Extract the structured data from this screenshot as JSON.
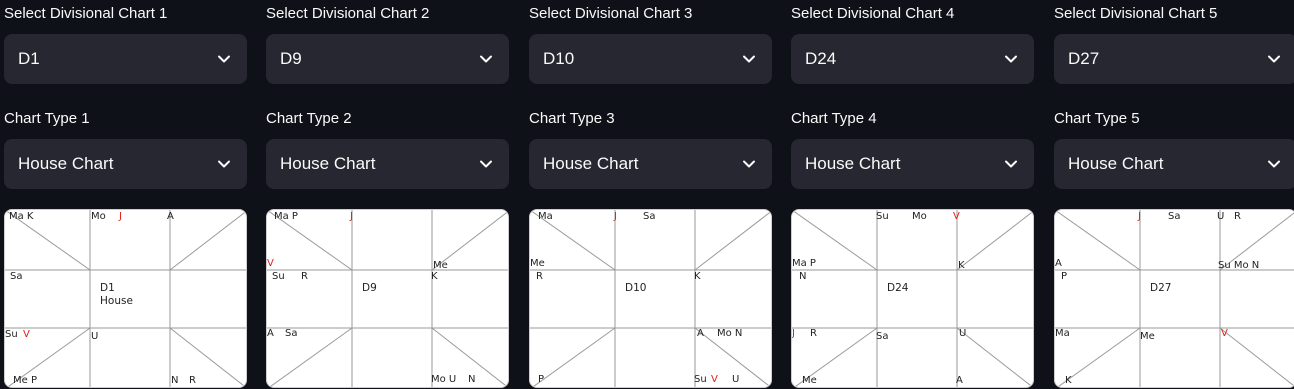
{
  "divisional_labels": [
    "Select Divisional Chart 1",
    "Select Divisional Chart 2",
    "Select Divisional Chart 3",
    "Select Divisional Chart 4",
    "Select Divisional Chart 5"
  ],
  "divisional_values": [
    "D1",
    "D9",
    "D10",
    "D24",
    "D27"
  ],
  "type_labels": [
    "Chart Type 1",
    "Chart Type 2",
    "Chart Type 3",
    "Chart Type 4",
    "Chart Type 5"
  ],
  "type_values": [
    "House Chart",
    "House Chart",
    "House Chart",
    "House Chart",
    "House Chart"
  ],
  "icons": {
    "dropdown": "chevron-down-icon"
  },
  "colors": {
    "background": "#0e1117",
    "select_bg": "#262730",
    "chart_bg": "#ffffff",
    "planet_red": "#e0201a"
  },
  "charts": [
    {
      "title": "D1",
      "subtitle": "House",
      "planets": [
        {
          "text": "Ma K",
          "red": false
        },
        {
          "text": "Mo",
          "red": false
        },
        {
          "text": "J",
          "red": true
        },
        {
          "text": "A",
          "red": false
        },
        {
          "text": "Sa",
          "red": false
        },
        {
          "text": "Su",
          "red": false
        },
        {
          "text": "V",
          "red": true
        },
        {
          "text": "U",
          "red": false
        },
        {
          "text": "Me P",
          "red": false
        },
        {
          "text": "N",
          "red": false
        },
        {
          "text": "R",
          "red": false
        }
      ]
    },
    {
      "title": "D9",
      "subtitle": "",
      "planets": [
        {
          "text": "Ma P",
          "red": false
        },
        {
          "text": "J",
          "red": true
        },
        {
          "text": "V",
          "red": true
        },
        {
          "text": "Me",
          "red": false
        },
        {
          "text": "Su",
          "red": false
        },
        {
          "text": "R",
          "red": false
        },
        {
          "text": "K",
          "red": false
        },
        {
          "text": "A",
          "red": false
        },
        {
          "text": "Sa",
          "red": false
        },
        {
          "text": "Mo U",
          "red": false
        },
        {
          "text": "N",
          "red": false
        }
      ]
    },
    {
      "title": "D10",
      "subtitle": "",
      "planets": [
        {
          "text": "Ma",
          "red": false
        },
        {
          "text": "J",
          "red": true
        },
        {
          "text": "Sa",
          "red": false
        },
        {
          "text": "Me",
          "red": false
        },
        {
          "text": "R",
          "red": false
        },
        {
          "text": "K",
          "red": false
        },
        {
          "text": "A",
          "red": false
        },
        {
          "text": "Mo N",
          "red": false
        },
        {
          "text": "P",
          "red": false
        },
        {
          "text": "Su",
          "red": false
        },
        {
          "text": "V",
          "red": true
        },
        {
          "text": "U",
          "red": false
        }
      ]
    },
    {
      "title": "D24",
      "subtitle": "",
      "planets": [
        {
          "text": "Su",
          "red": false
        },
        {
          "text": "Mo",
          "red": false
        },
        {
          "text": "V",
          "red": true
        },
        {
          "text": "Ma P",
          "red": false
        },
        {
          "text": "K",
          "red": false
        },
        {
          "text": "N",
          "red": false
        },
        {
          "text": "J",
          "red": true
        },
        {
          "text": "R",
          "red": false
        },
        {
          "text": "Sa",
          "red": false
        },
        {
          "text": "U",
          "red": false
        },
        {
          "text": "Me",
          "red": false
        },
        {
          "text": "A",
          "red": false
        }
      ]
    },
    {
      "title": "D27",
      "subtitle": "",
      "planets": [
        {
          "text": "J",
          "red": true
        },
        {
          "text": "Sa",
          "red": false
        },
        {
          "text": "U",
          "red": false
        },
        {
          "text": "R",
          "red": false
        },
        {
          "text": "A",
          "red": false
        },
        {
          "text": "Su Mo N",
          "red": false
        },
        {
          "text": "P",
          "red": false
        },
        {
          "text": "Ma",
          "red": false
        },
        {
          "text": "Me",
          "red": false
        },
        {
          "text": "V",
          "red": true
        },
        {
          "text": "K",
          "red": false
        }
      ]
    }
  ]
}
